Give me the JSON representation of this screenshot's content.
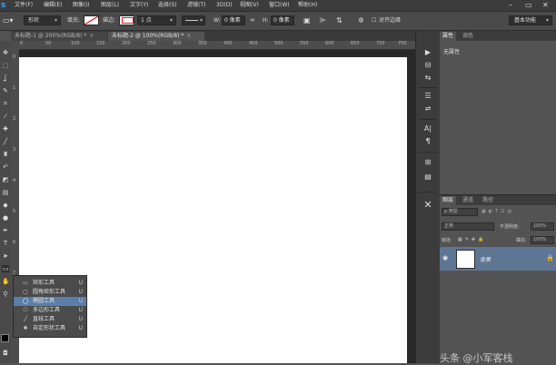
{
  "app": {
    "logo": "s"
  },
  "menu": [
    "文件(F)",
    "编辑(E)",
    "图像(I)",
    "图层(L)",
    "文字(Y)",
    "选择(S)",
    "滤镜(T)",
    "3D(D)",
    "视图(V)",
    "窗口(W)",
    "帮助(H)"
  ],
  "window_controls": [
    "–",
    "▭",
    "✕"
  ],
  "options_bar": {
    "mode_value": "形状",
    "fill_label": "填充:",
    "stroke_label": "描边:",
    "stroke_width": "1 点",
    "w_label": "W:",
    "w_value": "0 像素",
    "link_icon": "∞",
    "h_label": "H:",
    "h_value": "0 像素",
    "align_edges_label": "对齐边缘",
    "workspace": "基本功能"
  },
  "tabs": [
    {
      "label": "未标题-1 @ 200%(RGB/8) *",
      "close": "×"
    },
    {
      "label": "未标题-2 @ 100%(RGB/8) *",
      "close": "×"
    }
  ],
  "ruler_h": [
    "0",
    "50",
    "100",
    "150",
    "200",
    "250",
    "300",
    "350",
    "400",
    "450",
    "500",
    "550",
    "600",
    "650",
    "700",
    "750"
  ],
  "ruler_v": [
    "0",
    "1",
    "2",
    "3",
    "4",
    "5",
    "6",
    "7",
    "8",
    "9"
  ],
  "flyout": [
    {
      "icon": "▭",
      "label": "矩形工具",
      "shortcut": "U"
    },
    {
      "icon": "▢",
      "label": "圆角矩形工具",
      "shortcut": "U"
    },
    {
      "icon": "◯",
      "label": "椭圆工具",
      "shortcut": "U",
      "selected": true
    },
    {
      "icon": "⬠",
      "label": "多边形工具",
      "shortcut": "U"
    },
    {
      "icon": "╱",
      "label": "直线工具",
      "shortcut": "U"
    },
    {
      "icon": "✱",
      "label": "自定形状工具",
      "shortcut": "U"
    }
  ],
  "properties_panel": {
    "tabs": [
      "属性",
      "调色"
    ],
    "content": "无属性"
  },
  "layers_panel": {
    "tabs": [
      "图层",
      "通道",
      "路径"
    ],
    "filter": "ρ 类型",
    "blend_mode": "正常",
    "opacity_label": "不透明度:",
    "opacity_value": "100%",
    "lock_label": "锁定:",
    "fill_label": "填充:",
    "fill_value": "100%",
    "layer_name": "背景"
  },
  "watermark": "头条 @小军客栈"
}
